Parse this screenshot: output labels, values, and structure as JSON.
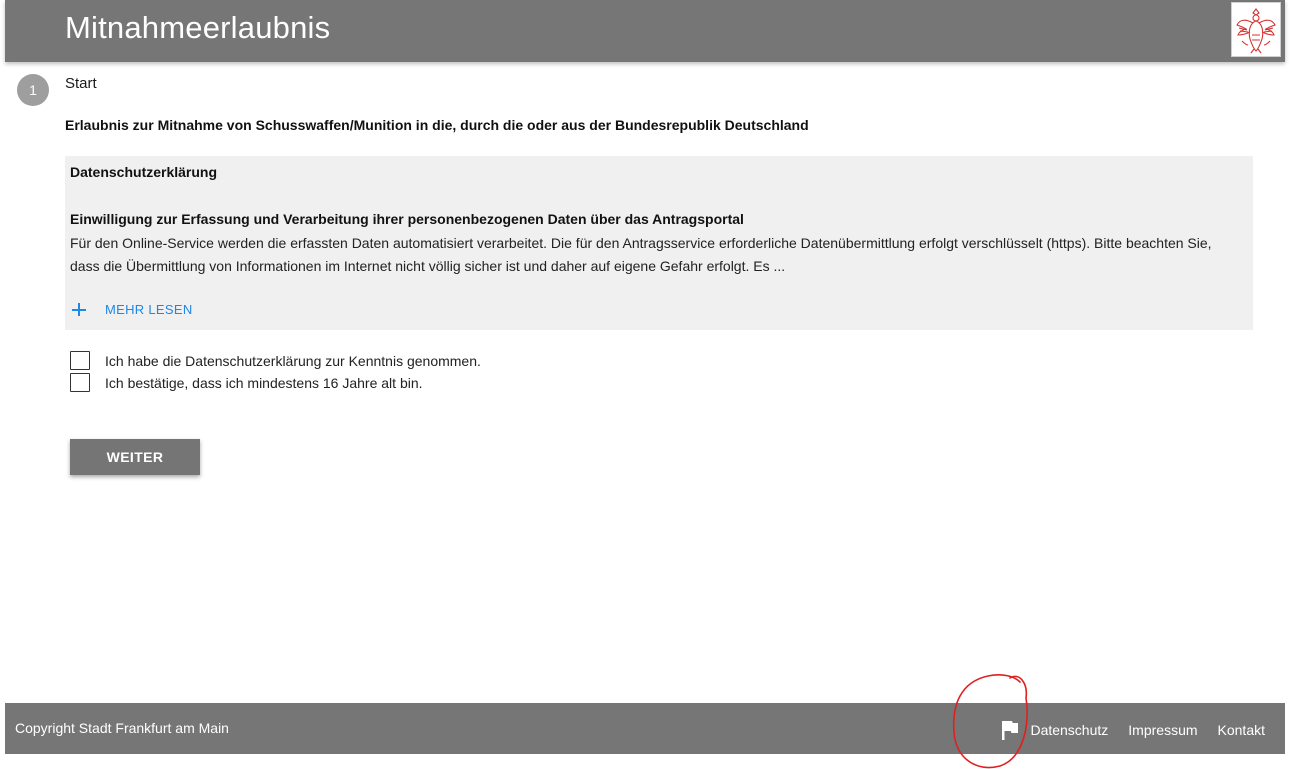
{
  "header": {
    "title": "Mitnahmeerlaubnis"
  },
  "step": {
    "number": "1",
    "label": "Start"
  },
  "form": {
    "heading": "Erlaubnis zur Mitnahme von Schusswaffen/Munition in die, durch die oder aus der Bundesrepublik Deutschland"
  },
  "privacy": {
    "title": "Datenschutzerklärung",
    "consent_title": "Einwilligung zur Erfassung und Verarbeitung ihrer personenbezogenen Daten über das Antragsportal",
    "consent_text": "Für den Online-Service werden die erfassten Daten automatisiert verarbeitet. Die für den Antragsservice erforderliche Datenübermittlung erfolgt verschlüsselt (https). Bitte beachten Sie, dass die Übermittlung von Informationen im Internet nicht völlig sicher ist und daher auf eigene Gefahr erfolgt. Es ...",
    "more_label": "MEHR LESEN"
  },
  "checkboxes": [
    {
      "label": "Ich habe die Datenschutzerklärung zur Kenntnis genommen.",
      "checked": false
    },
    {
      "label": "Ich bestätige, dass ich mindestens 16 Jahre alt bin.",
      "checked": false
    }
  ],
  "buttons": {
    "next_label": "WEITER"
  },
  "footer": {
    "copyright": "Copyright Stadt Frankfurt am Main",
    "links": [
      "Datenschutz",
      "Impressum",
      "Kontakt"
    ]
  },
  "colors": {
    "header_bg": "#767676",
    "link_blue": "#1e88e5",
    "annotation_red": "#e02020"
  },
  "icons": {
    "logo": "frankfurt-eagle-logo",
    "more": "plus-icon",
    "footer": "flag-icon"
  }
}
